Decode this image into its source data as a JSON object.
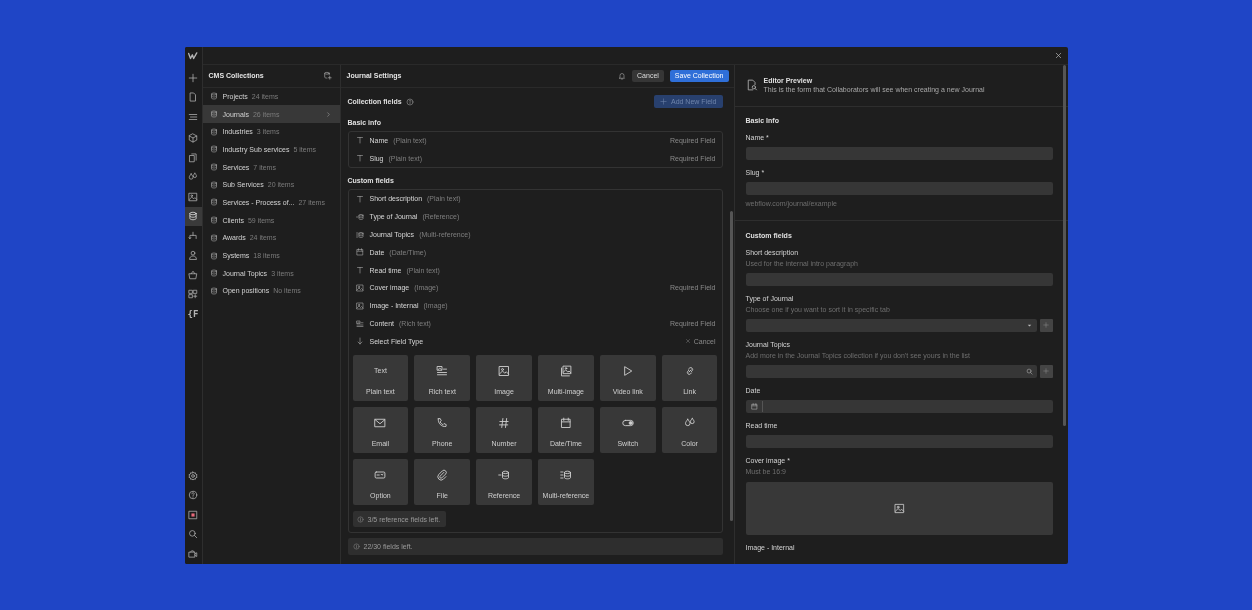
{
  "rail": {
    "groups": [
      [
        {
          "kind": "logo",
          "selected": false
        }
      ],
      [
        {
          "kind": "plus",
          "selected": false
        },
        {
          "kind": "page",
          "selected": false
        },
        {
          "kind": "lines",
          "selected": false
        }
      ],
      [
        {
          "kind": "cube",
          "selected": false
        },
        {
          "kind": "pages",
          "selected": false
        },
        {
          "kind": "drops",
          "selected": false
        },
        {
          "kind": "image",
          "selected": false
        },
        {
          "kind": "database",
          "selected": true
        },
        {
          "kind": "flow",
          "selected": false
        },
        {
          "kind": "user",
          "selected": false
        },
        {
          "kind": "basket",
          "selected": false
        },
        {
          "kind": "apps",
          "selected": false
        },
        {
          "kind": "text",
          "label": "{F",
          "selected": false
        }
      ]
    ],
    "bottom": [
      {
        "kind": "gear",
        "selected": false
      },
      {
        "kind": "help",
        "selected": false
      },
      {
        "kind": "record",
        "selected": false
      },
      {
        "kind": "search",
        "selected": false
      },
      {
        "kind": "camera",
        "selected": false
      }
    ]
  },
  "collections": {
    "title": "CMS Collections",
    "items": [
      {
        "name": "Projects",
        "count": "24 items",
        "selected": false
      },
      {
        "name": "Journals",
        "count": "26 items",
        "selected": true
      },
      {
        "name": "Industries",
        "count": "3 items",
        "selected": false
      },
      {
        "name": "Industry Sub services",
        "count": "5 items",
        "selected": false
      },
      {
        "name": "Services",
        "count": "7 items",
        "selected": false
      },
      {
        "name": "Sub Services",
        "count": "20 items",
        "selected": false
      },
      {
        "name": "Services - Process of...",
        "count": "27 items",
        "selected": false
      },
      {
        "name": "Clients",
        "count": "59 items",
        "selected": false
      },
      {
        "name": "Awards",
        "count": "24 items",
        "selected": false
      },
      {
        "name": "Systems",
        "count": "18 items",
        "selected": false
      },
      {
        "name": "Journal Topics",
        "count": "3 items",
        "selected": false
      },
      {
        "name": "Open positions",
        "count": "No items",
        "selected": false
      }
    ]
  },
  "settings": {
    "title": "Journal Settings",
    "cancel": "Cancel",
    "save": "Save Collection",
    "fields_title": "Collection fields",
    "add_field": {
      "label": "Add New Field",
      "disabled": true
    },
    "basic_title": "Basic info",
    "basic_fields": [
      {
        "kind": "text",
        "name": "Name",
        "type": "(Plain text)",
        "note": "Required Field"
      },
      {
        "kind": "text",
        "name": "Slug",
        "type": "(Plain text)",
        "note": "Required Field"
      }
    ],
    "custom_title": "Custom fields",
    "custom_fields": [
      {
        "kind": "text",
        "name": "Short description",
        "type": "(Plain text)"
      },
      {
        "kind": "reference",
        "name": "Type of Journal",
        "type": "(Reference)"
      },
      {
        "kind": "multiref",
        "name": "Journal Topics",
        "type": "(Multi-reference)"
      },
      {
        "kind": "calendar",
        "name": "Date",
        "type": "(Date/Time)"
      },
      {
        "kind": "text",
        "name": "Read time",
        "type": "(Plain text)"
      },
      {
        "kind": "image",
        "name": "Cover image",
        "type": "(Image)",
        "note": "Required Field"
      },
      {
        "kind": "image",
        "name": "Image - Internal",
        "type": "(Image)"
      },
      {
        "kind": "richtext",
        "name": "Content",
        "type": "(Rich text)",
        "note": "Required Field"
      }
    ],
    "select_row": {
      "label": "Select Field Type",
      "cancel": "Cancel"
    },
    "field_types": [
      {
        "kind": "text",
        "icon_text": "Text",
        "label": "Plain text"
      },
      {
        "kind": "richtext",
        "label": "Rich text"
      },
      {
        "kind": "image",
        "label": "Image"
      },
      {
        "kind": "multiimage",
        "label": "Multi-image"
      },
      {
        "kind": "play",
        "label": "Video link"
      },
      {
        "kind": "link",
        "label": "Link"
      },
      {
        "kind": "mail",
        "label": "Email"
      },
      {
        "kind": "phone",
        "label": "Phone"
      },
      {
        "kind": "hash",
        "label": "Number"
      },
      {
        "kind": "calendar",
        "label": "Date/Time"
      },
      {
        "kind": "switch",
        "label": "Switch"
      },
      {
        "kind": "drops",
        "label": "Color"
      },
      {
        "kind": "option",
        "label": "Option"
      },
      {
        "kind": "clip",
        "label": "File"
      },
      {
        "kind": "reference",
        "label": "Reference"
      },
      {
        "kind": "multiref",
        "label": "Multi-reference"
      }
    ],
    "reference_note": "3/5 reference fields left.",
    "fields_left": "22/30 fields left."
  },
  "preview": {
    "title": "Editor Preview",
    "subtitle": "This is the form that Collaborators will see when creating a new Journal",
    "sections": [
      {
        "title": "Basic Info",
        "fields": [
          {
            "kind": "text",
            "label": "Name *"
          },
          {
            "kind": "text",
            "label": "Slug *",
            "hint_below": "webflow.com/journal/example"
          }
        ]
      },
      {
        "title": "Custom fields",
        "fields": [
          {
            "kind": "text",
            "label": "Short description",
            "hint": "Used for the internal intro paragraph"
          },
          {
            "kind": "select",
            "label": "Type of Journal",
            "hint": "Choose one if you want to sort it in specific tab"
          },
          {
            "kind": "search",
            "label": "Journal Topics",
            "hint": "Add more in the Journal Topics collection if you don't see yours in the list"
          },
          {
            "kind": "date",
            "label": "Date"
          },
          {
            "kind": "text",
            "label": "Read time"
          },
          {
            "kind": "image",
            "label": "Cover image *",
            "hint": "Must be 16:9"
          },
          {
            "kind": "none",
            "label": "Image - Internal"
          }
        ]
      }
    ]
  }
}
